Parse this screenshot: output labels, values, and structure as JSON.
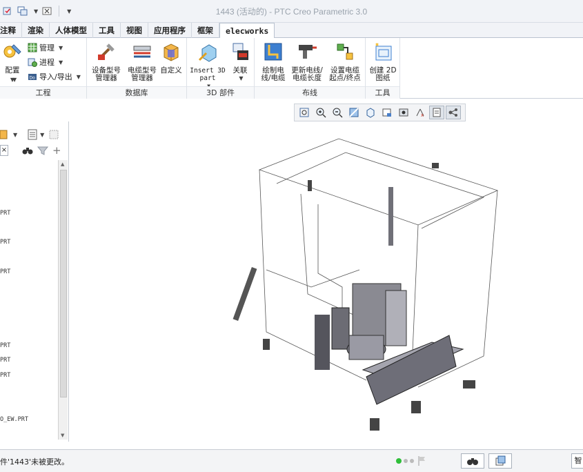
{
  "window": {
    "title": "1443 (活动的) - PTC Creo Parametric 3.0"
  },
  "quick_access": {
    "icons": [
      "regenerate-icon",
      "windows-icon",
      "close-window-icon",
      "customize-icon"
    ]
  },
  "tabs": [
    {
      "label": "注释"
    },
    {
      "label": "渲染"
    },
    {
      "label": "人体模型"
    },
    {
      "label": "工具"
    },
    {
      "label": "视图"
    },
    {
      "label": "应用程序"
    },
    {
      "label": "框架"
    },
    {
      "label": "elecworks",
      "active": true
    }
  ],
  "ribbon": {
    "groups": [
      {
        "label": "工程",
        "big": {
          "label": "配置"
        },
        "small": [
          {
            "label": "管理"
          },
          {
            "label": "进程"
          },
          {
            "label": "导入/导出"
          }
        ]
      },
      {
        "label": "数据库",
        "buttons": [
          {
            "label": "设备型号\n管理器"
          },
          {
            "label": "电缆型号\n管理器"
          },
          {
            "label": "自定义"
          }
        ]
      },
      {
        "label": "3D 部件",
        "buttons": [
          {
            "label": "Insert 3D\npart"
          },
          {
            "label": "关联"
          }
        ]
      },
      {
        "label": "布线",
        "buttons": [
          {
            "label": "绘制电\n线/电缆"
          },
          {
            "label": "更新电线/\n电缆长度"
          },
          {
            "label": "设置电缆\n起点/终点"
          }
        ]
      },
      {
        "label": "工具",
        "buttons": [
          {
            "label": "创建 2D\n图纸"
          }
        ]
      }
    ]
  },
  "model_tree": {
    "items": [
      "PRT",
      "PRT",
      "PRT",
      "PRT",
      "PRT",
      "PRT",
      "O_EW.PRT"
    ]
  },
  "graphics_toolbar": {
    "icons": [
      "refit-icon",
      "zoom-in-icon",
      "zoom-out-icon",
      "repaint-icon",
      "display-style-icon",
      "saved-views-icon",
      "view-manager-icon",
      "perspective-icon",
      "spin-center-icon",
      "annotation-display-icon"
    ]
  },
  "status": {
    "message": "件'1443'未被更改。",
    "smart_label": "智"
  }
}
